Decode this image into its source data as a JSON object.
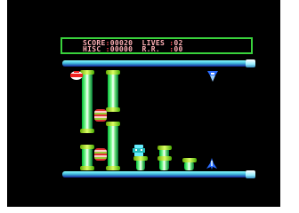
{
  "hud": {
    "score_label": "SCORE",
    "score_value": "00020",
    "hisc_label": "HISC",
    "hisc_value": "00000",
    "lives_label": "LIVES",
    "lives_value": "02",
    "rr_label": "R.R.",
    "rr_value": "00"
  },
  "colors": {
    "hud_border": "#39d23c",
    "hud_text": "#ff4b56",
    "rail": "#4bd",
    "pipe": "#3c6"
  },
  "icons": [
    "player-ship-icon",
    "enemy-drone-icon",
    "crab-pod-icon",
    "alien-robot-icon"
  ]
}
